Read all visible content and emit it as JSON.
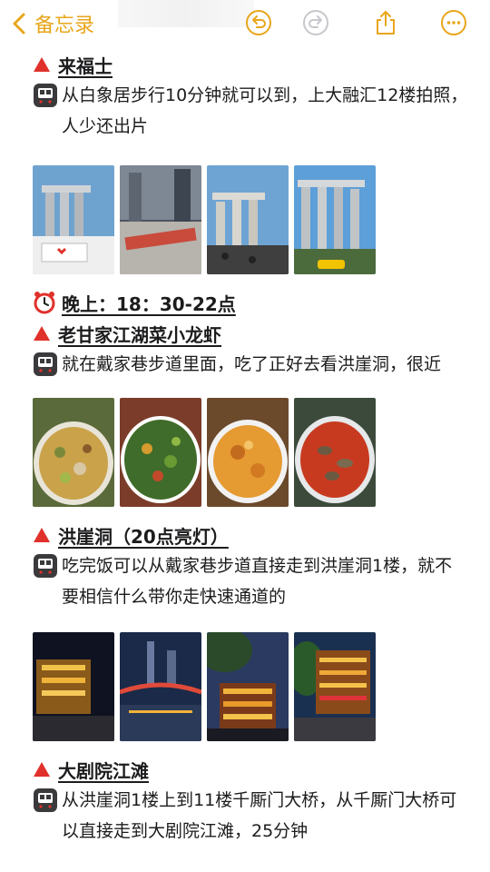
{
  "navbar": {
    "back_label": "备忘录"
  },
  "sections": [
    {
      "heading": "来福士",
      "text": "从白象居步行10分钟就可以到，上大融汇12楼拍照，人少还出片"
    },
    {
      "time_heading": "晚上：18：30-22点",
      "heading": "老甘家江湖菜小龙虾",
      "text": "就在戴家巷步道里面，吃了正好去看洪崖洞，很近"
    },
    {
      "heading": "洪崖洞（20点亮灯）",
      "text": "吃完饭可以从戴家巷步道直接走到洪崖洞1楼，就不要相信什么带你走快速通道的"
    },
    {
      "heading": "大剧院江滩",
      "text": "从洪崖洞1楼上到11楼千厮门大桥，从千厮门大桥可以直接走到大剧院江滩，25分钟"
    }
  ],
  "colors": {
    "accent": "#e8a61a",
    "marker_red": "#e0312b",
    "metro": "#3a3a3c"
  }
}
